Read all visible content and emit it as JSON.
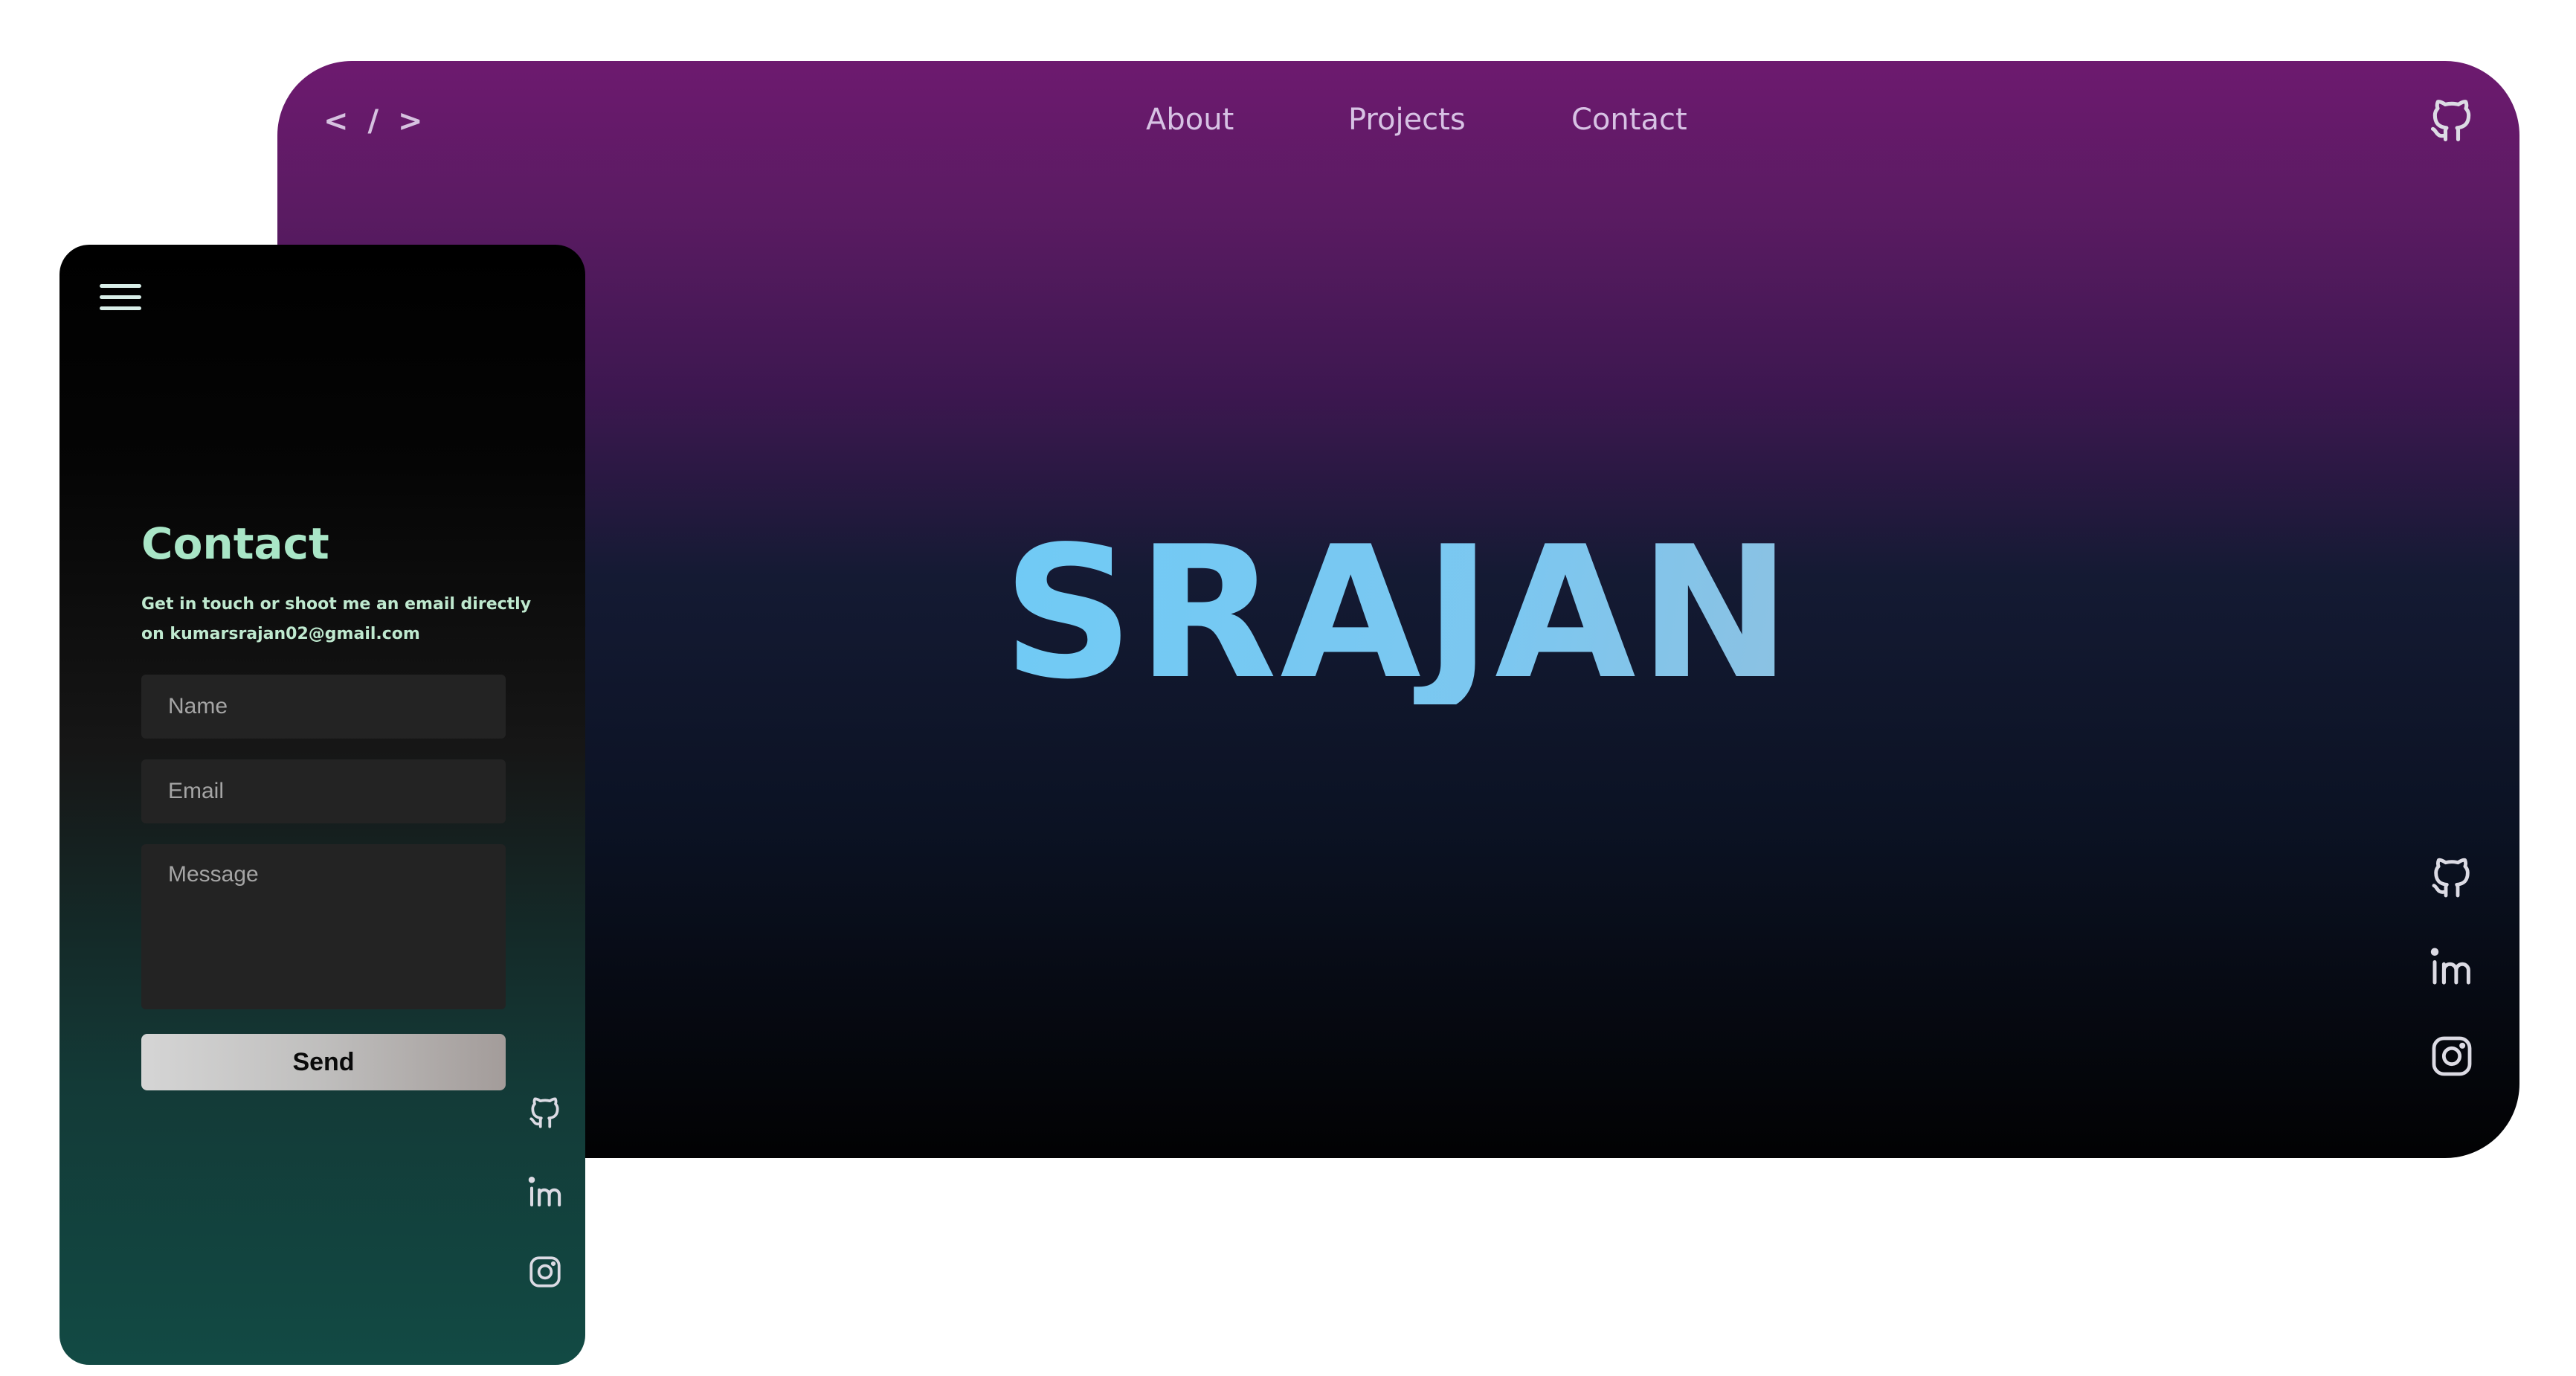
{
  "desktop": {
    "logo": "< / >",
    "nav": {
      "about": "About",
      "projects": "Projects",
      "contact": "Contact"
    },
    "hero_name": "SRAJAN",
    "icons": {
      "header": "github-icon",
      "social": [
        "github-icon",
        "linkedin-icon",
        "instagram-icon"
      ]
    }
  },
  "mobile": {
    "menu_icon": "hamburger-icon",
    "contact": {
      "title": "Contact",
      "description": "Get in touch or shoot me an email directly on kumarsrajan02@gmail.com",
      "name_placeholder": "Name",
      "email_placeholder": "Email",
      "message_placeholder": "Message",
      "send_label": "Send"
    },
    "icons": {
      "social": [
        "github-icon",
        "linkedin-icon",
        "instagram-icon"
      ]
    }
  },
  "colors": {
    "desktop_top": "#6d1a6f",
    "desktop_bottom": "#020203",
    "mobile_accent": "#a9e6c7",
    "mobile_bottom": "#124a44",
    "hero_gradient_start": "#cfe4ff",
    "hero_gradient_end": "#b2b3bf"
  }
}
